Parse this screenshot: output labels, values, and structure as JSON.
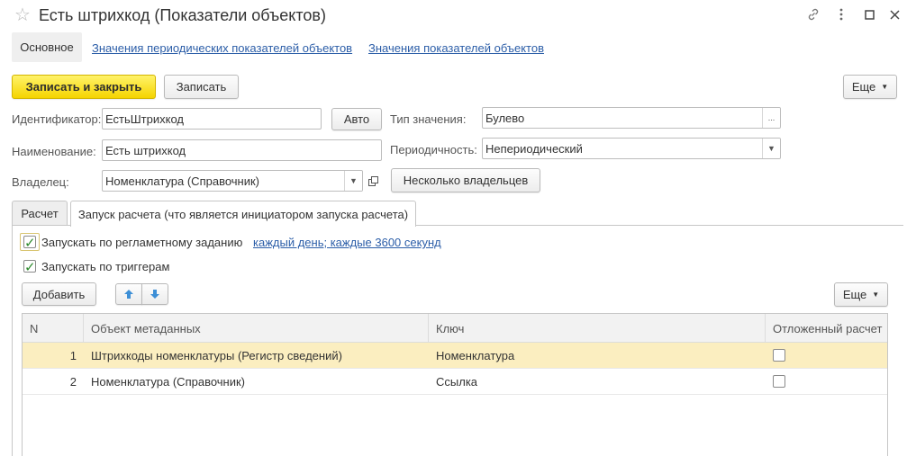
{
  "window": {
    "title": "Есть штрихкод (Показатели объектов)",
    "star_icon": "star-icon",
    "controls": [
      "link-icon",
      "more-icon",
      "maximize-icon",
      "close-icon"
    ]
  },
  "nav": {
    "active": "Основное",
    "links": [
      "Значения периодических показателей объектов",
      "Значения показателей объектов"
    ]
  },
  "toolbar": {
    "save_close": "Записать и закрыть",
    "save": "Записать",
    "more": "Еще"
  },
  "form": {
    "id_label": "Идентификатор:",
    "id_value": "ЕстьШтрихкод",
    "auto_button": "Авто",
    "name_label": "Наименование:",
    "name_value": "Есть штрихкод",
    "owner_label": "Владелец:",
    "owner_value": "Номенклатура (Справочник)",
    "value_type_label": "Тип значения:",
    "value_type_value": "Булево",
    "periodicity_label": "Периодичность:",
    "periodicity_value": "Непериодический",
    "several_owners_button": "Несколько владельцев"
  },
  "tabs": [
    "Расчет",
    "Запуск расчета (что является инициатором запуска расчета)"
  ],
  "launch": {
    "scheduled_label": "Запускать по регламетному заданию",
    "scheduled_checked": true,
    "schedule_link": "каждый день; каждые 3600 секунд",
    "triggers_label": "Запускать по триггерам",
    "triggers_checked": true
  },
  "table_toolbar": {
    "add": "Добавить",
    "more": "Еще"
  },
  "table": {
    "columns": [
      "N",
      "Объект метаданных",
      "Ключ",
      "Отложенный расчет"
    ],
    "rows": [
      {
        "n": "1",
        "object": "Штрихкоды номенклатуры (Регистр сведений)",
        "key": "Номенклатура",
        "deferred": false,
        "selected": true
      },
      {
        "n": "2",
        "object": "Номенклатура (Справочник)",
        "key": "Ссылка",
        "deferred": false,
        "selected": false
      }
    ]
  },
  "colors": {
    "primary_button": "#f5d400",
    "link": "#2c5ea8",
    "selected_row": "#fbeec0",
    "check": "#2e8b2e"
  }
}
